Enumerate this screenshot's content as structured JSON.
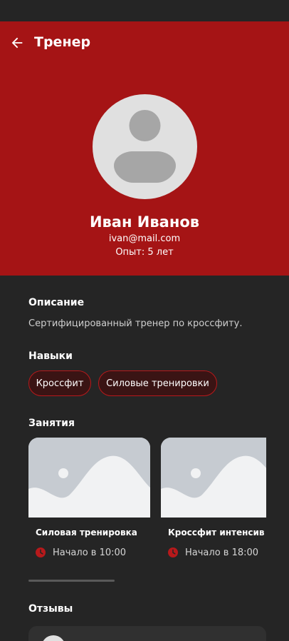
{
  "header": {
    "title": "Тренер"
  },
  "profile": {
    "name": "Иван Иванов",
    "email": "ivan@mail.com",
    "experience": "Опыт: 5 лет"
  },
  "description": {
    "title": "Описание",
    "text": "Сертифицированный тренер по кроссфиту."
  },
  "skills": {
    "title": "Навыки",
    "items": [
      "Кроссфит",
      "Силовые тренировки"
    ]
  },
  "lessons": {
    "title": "Занятия",
    "items": [
      {
        "title": "Силовая тренировка",
        "time": "Начало в 10:00"
      },
      {
        "title": "Кроссфит интенсив",
        "time": "Начало в 18:00"
      }
    ]
  },
  "reviews": {
    "title": "Отзывы"
  },
  "colors": {
    "accent": "#a51415",
    "background": "#252525",
    "chip_border": "#b7191b"
  }
}
